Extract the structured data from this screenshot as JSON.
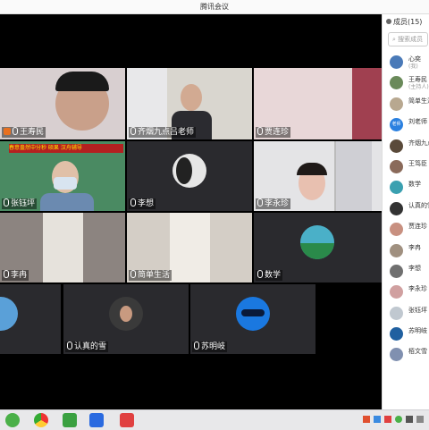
{
  "window": {
    "title": "腾讯会议"
  },
  "tiles": [
    {
      "name": "王寿民",
      "host": true
    },
    {
      "name": "齐烟九点吕老师"
    },
    {
      "name": "贾连珍"
    },
    {
      "name": "张钰坪"
    },
    {
      "name": "李想"
    },
    {
      "name": "李永珍"
    },
    {
      "name": "李冉"
    },
    {
      "name": "简单生活"
    },
    {
      "name": "数学"
    },
    {
      "name": ""
    },
    {
      "name": "认真的雪"
    },
    {
      "name": "苏明岐"
    }
  ],
  "banner_text": "春意盎然中分秒  硕果 汉舟辅导",
  "panel": {
    "title": "成员(15)",
    "search_placeholder": "搜索成员",
    "members": [
      {
        "name": "心奕",
        "sub": "(我)",
        "color": "#4a7ab8"
      },
      {
        "name": "王寿民",
        "sub": "(主持人)",
        "color": "#6a8a5a"
      },
      {
        "name": "简单生活",
        "sub": "",
        "color": "#b8a890"
      },
      {
        "name": "刘老师",
        "sub": "",
        "color": "#2a80e0",
        "badge": "老师"
      },
      {
        "name": "齐烟九点",
        "sub": "",
        "color": "#5a4a3a"
      },
      {
        "name": "王笃臣",
        "sub": "",
        "color": "#8a6a5a"
      },
      {
        "name": "数学",
        "sub": "",
        "color": "#3aa0b0"
      },
      {
        "name": "认真的雪",
        "sub": "",
        "color": "#333333"
      },
      {
        "name": "贾连珍",
        "sub": "",
        "color": "#c89080"
      },
      {
        "name": "李冉",
        "sub": "",
        "color": "#a09080"
      },
      {
        "name": "李想",
        "sub": "",
        "color": "#707070"
      },
      {
        "name": "李永珍",
        "sub": "",
        "color": "#d0a0a0"
      },
      {
        "name": "张钰坪",
        "sub": "",
        "color": "#c0c8d0"
      },
      {
        "name": "苏明岐",
        "sub": "",
        "color": "#2060a0"
      },
      {
        "name": "栢文雪",
        "sub": "",
        "color": "#8090b0"
      }
    ]
  },
  "taskbar": {
    "apps": [
      "wechat",
      "chrome",
      "app-green",
      "tencent-meeting",
      "wps"
    ]
  }
}
